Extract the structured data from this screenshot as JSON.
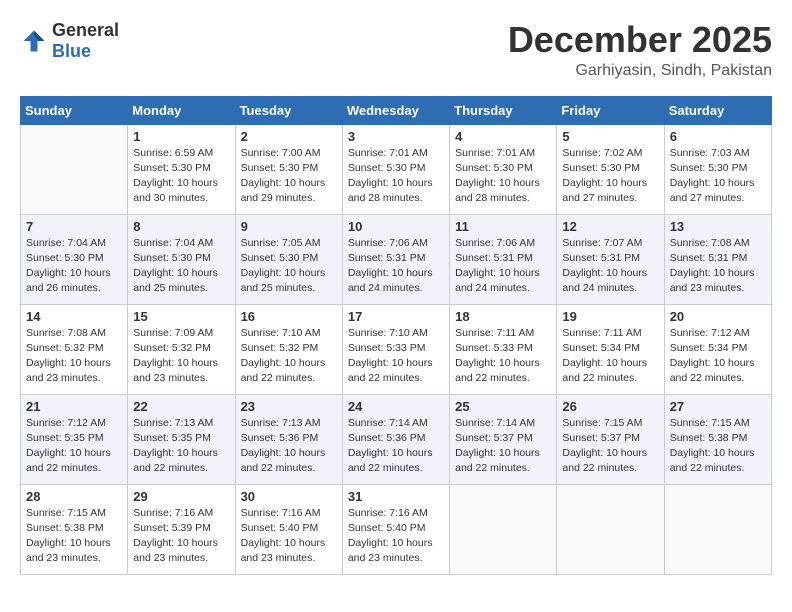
{
  "logo": {
    "text_general": "General",
    "text_blue": "Blue"
  },
  "header": {
    "month_year": "December 2025",
    "location": "Garhiyasin, Sindh, Pakistan"
  },
  "weekdays": [
    "Sunday",
    "Monday",
    "Tuesday",
    "Wednesday",
    "Thursday",
    "Friday",
    "Saturday"
  ],
  "weeks": [
    [
      {
        "num": "",
        "info": ""
      },
      {
        "num": "1",
        "info": "Sunrise: 6:59 AM\nSunset: 5:30 PM\nDaylight: 10 hours\nand 30 minutes."
      },
      {
        "num": "2",
        "info": "Sunrise: 7:00 AM\nSunset: 5:30 PM\nDaylight: 10 hours\nand 29 minutes."
      },
      {
        "num": "3",
        "info": "Sunrise: 7:01 AM\nSunset: 5:30 PM\nDaylight: 10 hours\nand 28 minutes."
      },
      {
        "num": "4",
        "info": "Sunrise: 7:01 AM\nSunset: 5:30 PM\nDaylight: 10 hours\nand 28 minutes."
      },
      {
        "num": "5",
        "info": "Sunrise: 7:02 AM\nSunset: 5:30 PM\nDaylight: 10 hours\nand 27 minutes."
      },
      {
        "num": "6",
        "info": "Sunrise: 7:03 AM\nSunset: 5:30 PM\nDaylight: 10 hours\nand 27 minutes."
      }
    ],
    [
      {
        "num": "7",
        "info": "Sunrise: 7:04 AM\nSunset: 5:30 PM\nDaylight: 10 hours\nand 26 minutes."
      },
      {
        "num": "8",
        "info": "Sunrise: 7:04 AM\nSunset: 5:30 PM\nDaylight: 10 hours\nand 25 minutes."
      },
      {
        "num": "9",
        "info": "Sunrise: 7:05 AM\nSunset: 5:30 PM\nDaylight: 10 hours\nand 25 minutes."
      },
      {
        "num": "10",
        "info": "Sunrise: 7:06 AM\nSunset: 5:31 PM\nDaylight: 10 hours\nand 24 minutes."
      },
      {
        "num": "11",
        "info": "Sunrise: 7:06 AM\nSunset: 5:31 PM\nDaylight: 10 hours\nand 24 minutes."
      },
      {
        "num": "12",
        "info": "Sunrise: 7:07 AM\nSunset: 5:31 PM\nDaylight: 10 hours\nand 24 minutes."
      },
      {
        "num": "13",
        "info": "Sunrise: 7:08 AM\nSunset: 5:31 PM\nDaylight: 10 hours\nand 23 minutes."
      }
    ],
    [
      {
        "num": "14",
        "info": "Sunrise: 7:08 AM\nSunset: 5:32 PM\nDaylight: 10 hours\nand 23 minutes."
      },
      {
        "num": "15",
        "info": "Sunrise: 7:09 AM\nSunset: 5:32 PM\nDaylight: 10 hours\nand 23 minutes."
      },
      {
        "num": "16",
        "info": "Sunrise: 7:10 AM\nSunset: 5:32 PM\nDaylight: 10 hours\nand 22 minutes."
      },
      {
        "num": "17",
        "info": "Sunrise: 7:10 AM\nSunset: 5:33 PM\nDaylight: 10 hours\nand 22 minutes."
      },
      {
        "num": "18",
        "info": "Sunrise: 7:11 AM\nSunset: 5:33 PM\nDaylight: 10 hours\nand 22 minutes."
      },
      {
        "num": "19",
        "info": "Sunrise: 7:11 AM\nSunset: 5:34 PM\nDaylight: 10 hours\nand 22 minutes."
      },
      {
        "num": "20",
        "info": "Sunrise: 7:12 AM\nSunset: 5:34 PM\nDaylight: 10 hours\nand 22 minutes."
      }
    ],
    [
      {
        "num": "21",
        "info": "Sunrise: 7:12 AM\nSunset: 5:35 PM\nDaylight: 10 hours\nand 22 minutes."
      },
      {
        "num": "22",
        "info": "Sunrise: 7:13 AM\nSunset: 5:35 PM\nDaylight: 10 hours\nand 22 minutes."
      },
      {
        "num": "23",
        "info": "Sunrise: 7:13 AM\nSunset: 5:36 PM\nDaylight: 10 hours\nand 22 minutes."
      },
      {
        "num": "24",
        "info": "Sunrise: 7:14 AM\nSunset: 5:36 PM\nDaylight: 10 hours\nand 22 minutes."
      },
      {
        "num": "25",
        "info": "Sunrise: 7:14 AM\nSunset: 5:37 PM\nDaylight: 10 hours\nand 22 minutes."
      },
      {
        "num": "26",
        "info": "Sunrise: 7:15 AM\nSunset: 5:37 PM\nDaylight: 10 hours\nand 22 minutes."
      },
      {
        "num": "27",
        "info": "Sunrise: 7:15 AM\nSunset: 5:38 PM\nDaylight: 10 hours\nand 22 minutes."
      }
    ],
    [
      {
        "num": "28",
        "info": "Sunrise: 7:15 AM\nSunset: 5:38 PM\nDaylight: 10 hours\nand 23 minutes."
      },
      {
        "num": "29",
        "info": "Sunrise: 7:16 AM\nSunset: 5:39 PM\nDaylight: 10 hours\nand 23 minutes."
      },
      {
        "num": "30",
        "info": "Sunrise: 7:16 AM\nSunset: 5:40 PM\nDaylight: 10 hours\nand 23 minutes."
      },
      {
        "num": "31",
        "info": "Sunrise: 7:16 AM\nSunset: 5:40 PM\nDaylight: 10 hours\nand 23 minutes."
      },
      {
        "num": "",
        "info": ""
      },
      {
        "num": "",
        "info": ""
      },
      {
        "num": "",
        "info": ""
      }
    ]
  ]
}
